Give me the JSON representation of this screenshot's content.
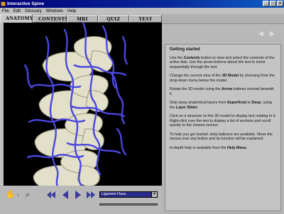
{
  "window": {
    "title": "Interactive Spine",
    "min": "_",
    "max": "□",
    "close": "×"
  },
  "menu": [
    {
      "label": "File"
    },
    {
      "label": "Edit"
    },
    {
      "label": "Glossary"
    },
    {
      "label": "Windows"
    },
    {
      "label": "Help"
    }
  ],
  "tabs": [
    {
      "label": "ANATOMY"
    },
    {
      "label": "CONTENTS"
    },
    {
      "label": "MRI"
    },
    {
      "label": "QUIZ"
    },
    {
      "label": "TEST"
    }
  ],
  "active_tab": "ANATOMY",
  "guide": {
    "heading": "Getting started",
    "p1_a": "Use the ",
    "p1_b": "Contents",
    "p1_c": " button to view and select the contents of the active disk. Use the arrow buttons above the text to move sequentially through the text.",
    "p2_a": "Change the current view of the ",
    "p2_b": "3D Model",
    "p2_c": " by choosing from the drop-down menu below the model.",
    "p3_a": "Rotate the 3D model using the ",
    "p3_b": "Arrow",
    "p3_c": " buttons centred beneath it.",
    "p4_a": "Strip away anatomical layers from ",
    "p4_b": "Superficial",
    "p4_c": " to ",
    "p4_d": "Deep",
    "p4_e": ", using the ",
    "p4_f": "Layer Slider",
    "p4_g": ".",
    "p5": "Click on a structure on the 3D model to display text relating to it. Right-click over the text to display a list of sections and scroll quickly to the chosen section.",
    "p6": "To help you get started, Help balloons are available. Move the mouse over any button and its function will be explained.",
    "p7_a": "In-depth help is available from the ",
    "p7_b": "Help Menu",
    "p7_c": "."
  },
  "layer_select": {
    "value": "Ligament Flava"
  },
  "icons": {
    "hand": "hand-icon",
    "magnifier": "magnifier-icon",
    "rewind": "rewind-icon",
    "back": "back-arrow-icon",
    "forward": "forward-arrow-icon",
    "fastforward": "fastforward-icon"
  },
  "colors": {
    "titlebar": "#000078",
    "bone": "#e4e2cc",
    "vessels": "#4a46e0",
    "select": "#2a2a8a"
  }
}
